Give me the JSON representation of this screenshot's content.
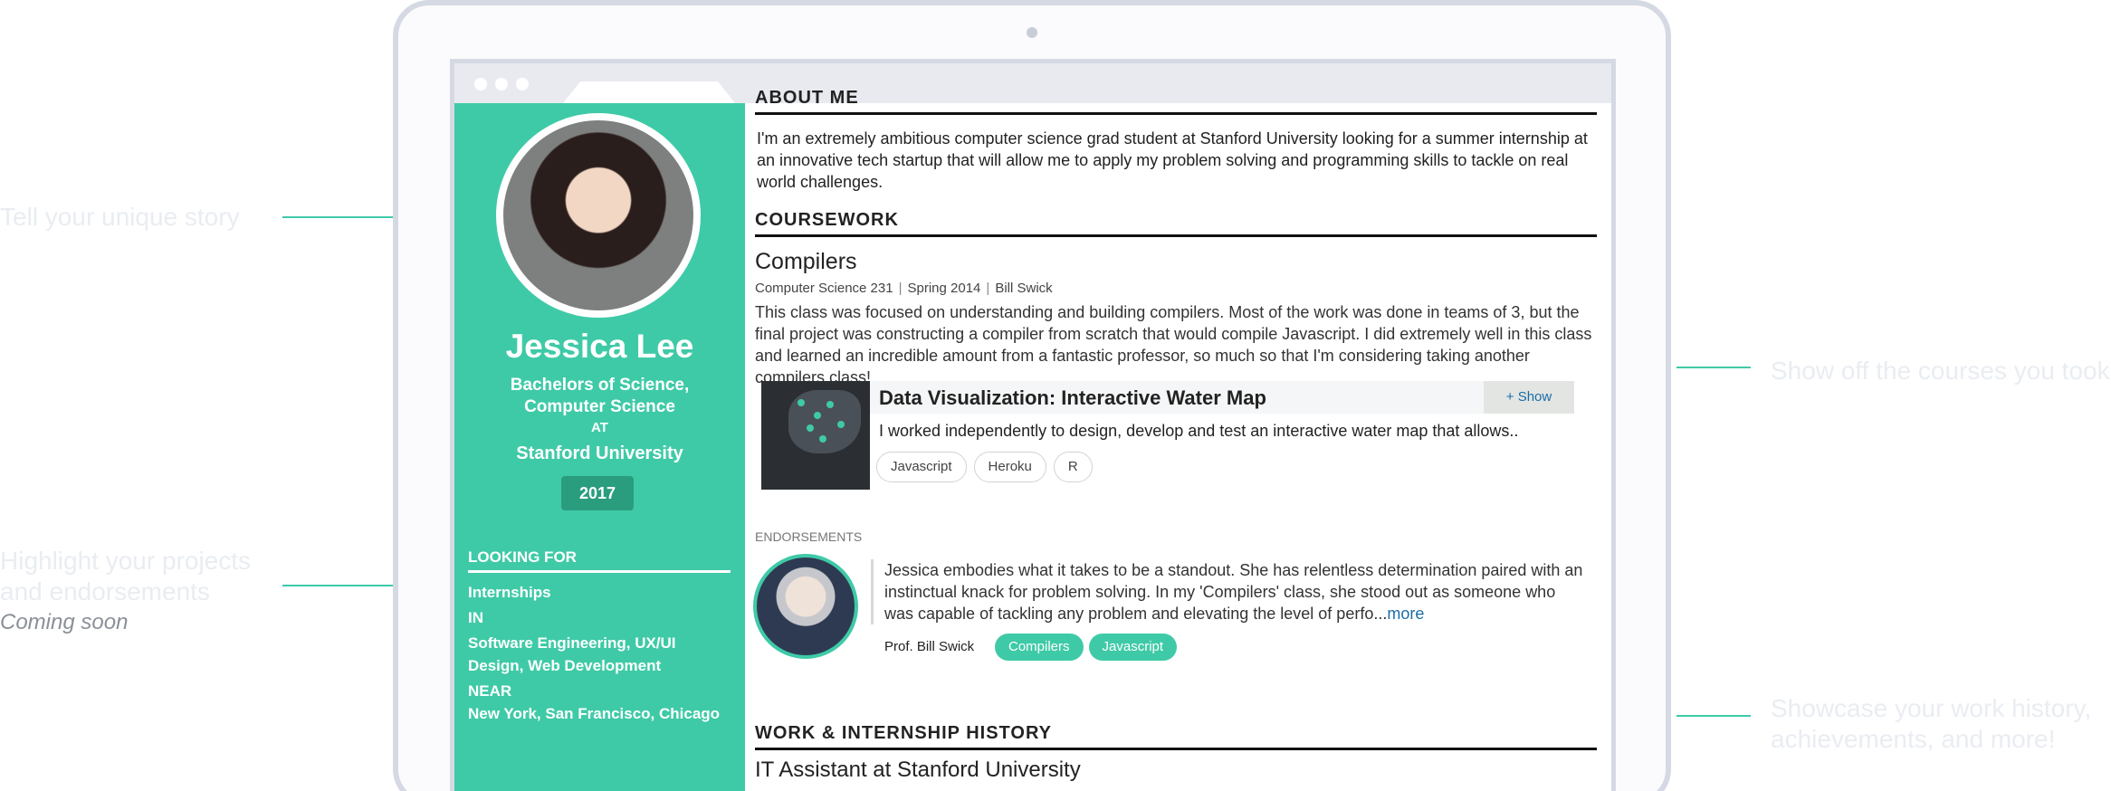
{
  "callouts": {
    "story": "Tell your unique story",
    "courses": "Show off the courses you took",
    "projects_line1": "Highlight your projects",
    "projects_line2": "and endorsements",
    "projects_soon": "Coming soon",
    "work_line1": "Showcase your work history,",
    "work_line2": "achievements, and more!"
  },
  "profile": {
    "name": "Jessica Lee",
    "degree_line1": "Bachelors of Science,",
    "degree_line2": "Computer Science",
    "at": "AT",
    "university": "Stanford University",
    "year": "2017"
  },
  "looking_for": {
    "title": "LOOKING FOR",
    "type": "Internships",
    "in_label": "IN",
    "fields_line1": "Software Engineering, UX/UI",
    "fields_line2": "Design, Web Development",
    "near_label": "NEAR",
    "locations": "New York, San Francisco, Chicago"
  },
  "about": {
    "heading": "ABOUT ME",
    "text": "I'm an extremely ambitious computer science grad student at Stanford University looking for a summer internship at an innovative tech startup that will allow me to apply my problem solving and programming skills to tackle on real world challenges."
  },
  "coursework": {
    "heading": "COURSEWORK",
    "course_title": "Compilers",
    "course_code": "Computer Science 231",
    "term": "Spring 2014",
    "instructor": "Bill Swick",
    "description": "This class was focused on understanding and building compilers. Most of the work was done in teams of 3, but the final project was constructing a compiler from scratch that would compile Javascript. I did extremely well in this class and learned an incredible amount from a fantastic professor, so much so that I'm considering taking another compilers class!",
    "project": {
      "title": "Data Visualization: Interactive Water Map",
      "show_label": "+ Show",
      "description": "I worked independently to design, develop and test an interactive water map that allows..",
      "tags": [
        "Javascript",
        "Heroku",
        "R"
      ]
    }
  },
  "endorsements": {
    "label": "ENDORSEMENTS",
    "quote": "Jessica embodies what it takes to be a standout. She has relentless determination paired with an instinctual knack for problem solving. In my 'Compilers' class, she stood out as someone who was capable of tackling any problem and elevating the level of perfo...",
    "more_label": "more",
    "endorser": "Prof. Bill Swick",
    "tags": [
      "Compilers",
      "Javascript"
    ]
  },
  "work": {
    "heading": "WORK & INTERNSHIP HISTORY",
    "first_title": "IT Assistant at Stanford University"
  },
  "colors": {
    "accent": "#3fcaa7",
    "frame": "#d5d9e4",
    "link": "#1a6da8"
  }
}
